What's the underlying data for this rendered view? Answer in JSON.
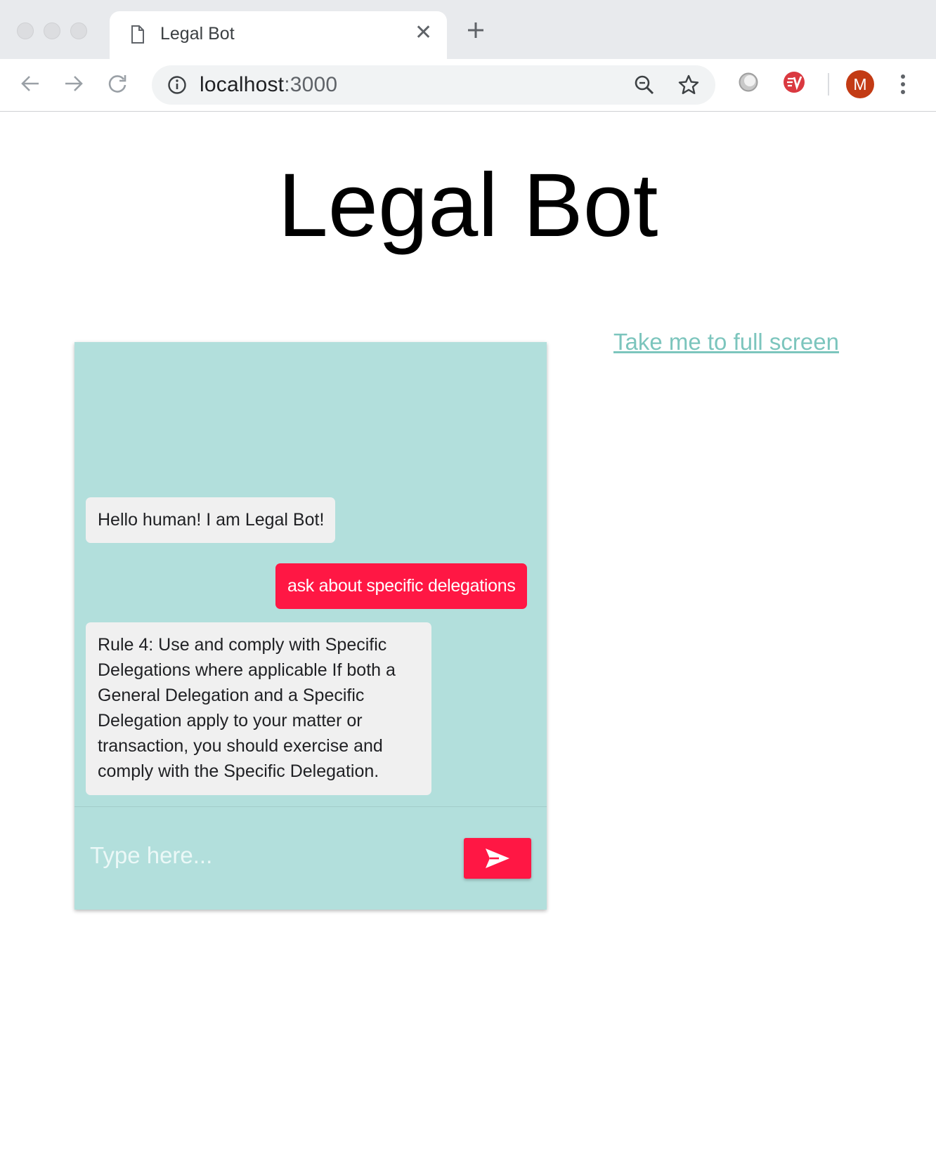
{
  "browser": {
    "tab": {
      "title": "Legal Bot"
    },
    "address": {
      "host": "localhost",
      "port": ":3000"
    },
    "profile_initial": "M",
    "icons": [
      "document-icon",
      "close-icon",
      "new-tab-icon",
      "back-icon",
      "forward-icon",
      "reload-icon",
      "site-info-icon",
      "zoom-icon",
      "bookmark-star-icon",
      "extension-icon",
      "expressvpn-icon",
      "menu-dots-icon"
    ]
  },
  "page": {
    "title": "Legal Bot",
    "fullscreen_link": "Take me to full screen"
  },
  "chat": {
    "messages": [
      {
        "sender": "bot",
        "text": "Hello human! I am Legal Bot!"
      },
      {
        "sender": "user",
        "text": "ask about specific delegations"
      },
      {
        "sender": "bot",
        "text": "Rule 4: Use and comply with Specific Delegations where applicable If both a General Delegation and a Specific Delegation apply to your matter or transaction, you should exercise and comply with the Specific Delegation."
      }
    ],
    "input_placeholder": "Type here...",
    "send_icon": "send-icon"
  },
  "colors": {
    "chat_background": "#b2dfdc",
    "accent": "#ff1744",
    "bot_bubble": "#f0f0f0",
    "link": "#7cc5bd"
  }
}
